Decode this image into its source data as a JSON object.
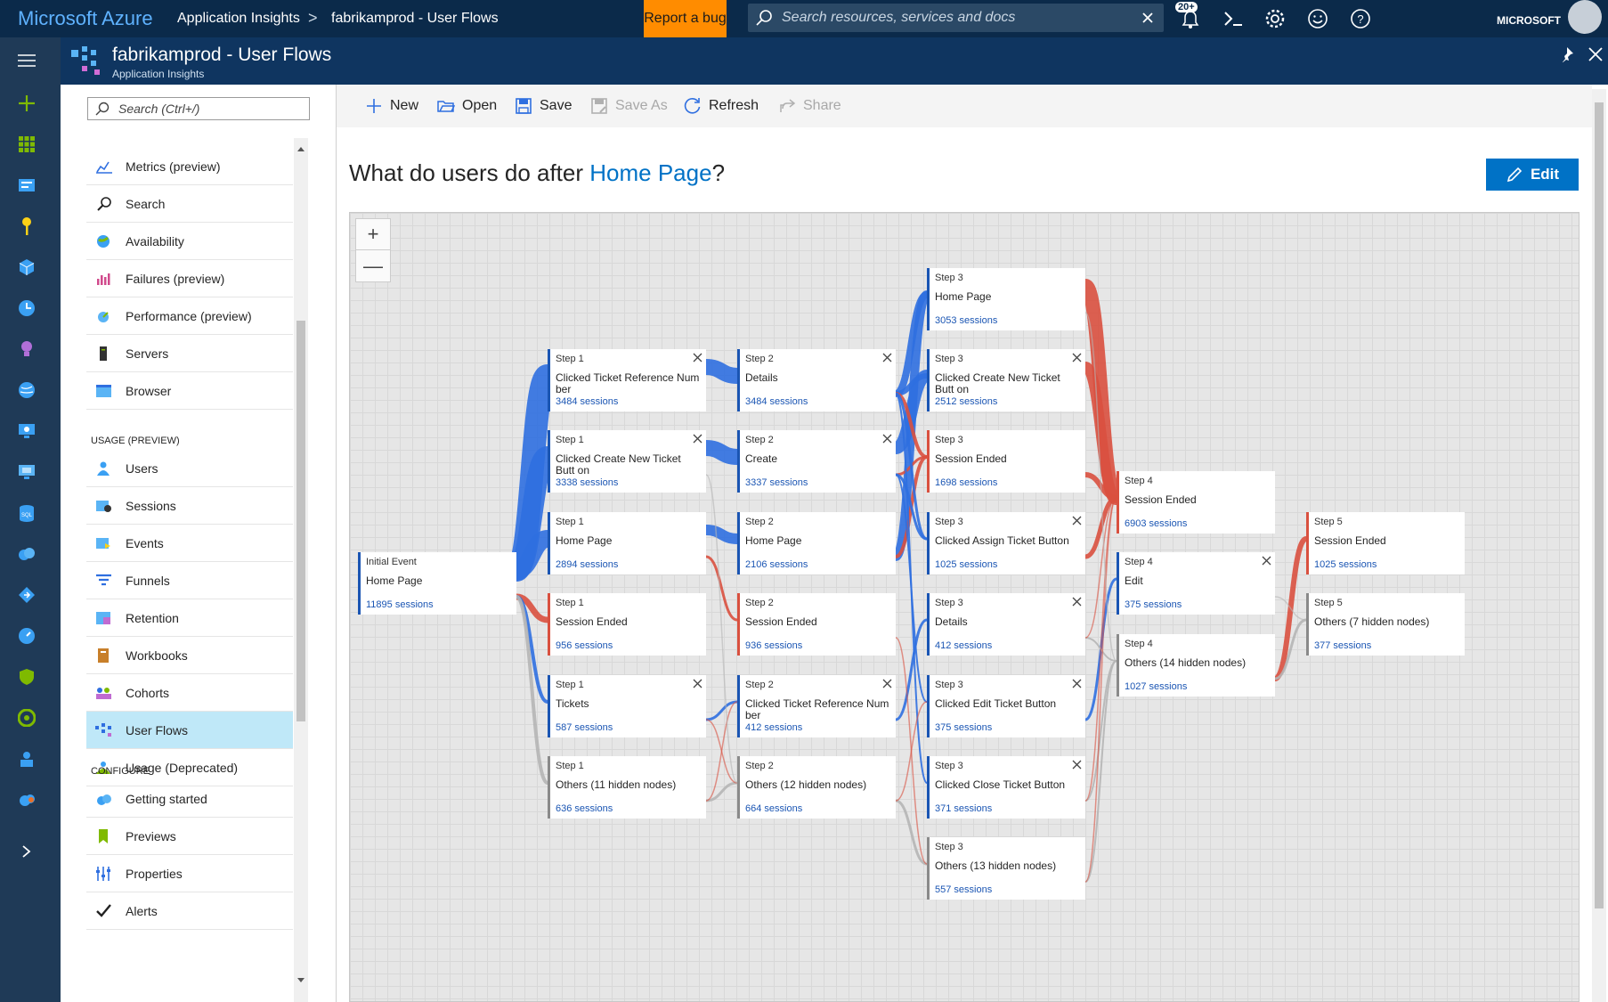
{
  "topbar": {
    "brand": "Microsoft Azure",
    "crumb_1": "Application Insights",
    "separator": ">",
    "crumb_2": "fabrikamprod - User Flows",
    "report_bug": "Report a bug",
    "search_placeholder": "Search resources, services and docs",
    "notifications_count": "20+",
    "account": "MICROSOFT"
  },
  "blade": {
    "title": "fabrikamprod - User Flows",
    "subtitle": "Application Insights"
  },
  "menu": {
    "search_placeholder": "Search (Ctrl+/)",
    "items_top": [
      {
        "label": "Metrics (preview)",
        "icon": "metrics-icon"
      },
      {
        "label": "Search",
        "icon": "search-icon"
      },
      {
        "label": "Availability",
        "icon": "availability-icon"
      },
      {
        "label": "Failures (preview)",
        "icon": "failures-icon"
      },
      {
        "label": "Performance (preview)",
        "icon": "performance-icon"
      },
      {
        "label": "Servers",
        "icon": "servers-icon"
      },
      {
        "label": "Browser",
        "icon": "browser-icon"
      }
    ],
    "section_usage": "USAGE (PREVIEW)",
    "items_usage": [
      {
        "label": "Users",
        "icon": "users-icon"
      },
      {
        "label": "Sessions",
        "icon": "sessions-icon"
      },
      {
        "label": "Events",
        "icon": "events-icon"
      },
      {
        "label": "Funnels",
        "icon": "funnels-icon"
      },
      {
        "label": "Retention",
        "icon": "retention-icon"
      },
      {
        "label": "Workbooks",
        "icon": "workbooks-icon"
      },
      {
        "label": "Cohorts",
        "icon": "cohorts-icon"
      },
      {
        "label": "User Flows",
        "icon": "user-flows-icon"
      },
      {
        "label": "Usage (Deprecated)",
        "icon": "usage-deprecated-icon"
      }
    ],
    "section_configure": "CONFIGURE",
    "items_configure": [
      {
        "label": "Getting started",
        "icon": "getting-started-icon"
      },
      {
        "label": "Previews",
        "icon": "previews-icon"
      },
      {
        "label": "Properties",
        "icon": "properties-icon"
      },
      {
        "label": "Alerts",
        "icon": "alerts-icon"
      }
    ]
  },
  "toolbar": {
    "new": "New",
    "open": "Open",
    "save": "Save",
    "save_as": "Save As",
    "refresh": "Refresh",
    "share": "Share"
  },
  "question": {
    "prefix": "What do users do after",
    "event": "Home Page",
    "suffix": "?"
  },
  "edit_label": "Edit",
  "colors": {
    "flow_blue": "#2f6fe0",
    "flow_red": "#d9503f",
    "flow_gray": "#b5b5b5",
    "accent": "#0072c6",
    "topbar": "#0b2a4a",
    "report_bug": "#ff8c00"
  },
  "flow": {
    "initial": {
      "step": "Initial Event",
      "name": "Home Page",
      "sessions": "11895 sessions"
    },
    "step1": [
      {
        "step": "Step 1",
        "name": "Clicked Ticket Reference Num ber",
        "sessions": "3484 sessions",
        "closable": true,
        "color": "blue"
      },
      {
        "step": "Step 1",
        "name": "Clicked Create New Ticket Butt on",
        "sessions": "3338 sessions",
        "closable": true,
        "color": "blue"
      },
      {
        "step": "Step 1",
        "name": "Home Page",
        "sessions": "2894 sessions",
        "closable": false,
        "color": "blue"
      },
      {
        "step": "Step 1",
        "name": "Session Ended",
        "sessions": "956 sessions",
        "closable": false,
        "color": "red"
      },
      {
        "step": "Step 1",
        "name": "Tickets",
        "sessions": "587 sessions",
        "closable": true,
        "color": "blue"
      },
      {
        "step": "Step 1",
        "name": "Others (11 hidden nodes)",
        "sessions": "636 sessions",
        "closable": false,
        "color": "gray"
      }
    ],
    "step2": [
      {
        "step": "Step 2",
        "name": "Details",
        "sessions": "3484 sessions",
        "closable": true,
        "color": "blue"
      },
      {
        "step": "Step 2",
        "name": "Create",
        "sessions": "3337 sessions",
        "closable": true,
        "color": "blue"
      },
      {
        "step": "Step 2",
        "name": "Home Page",
        "sessions": "2106 sessions",
        "closable": false,
        "color": "blue"
      },
      {
        "step": "Step 2",
        "name": "Session Ended",
        "sessions": "936 sessions",
        "closable": false,
        "color": "red"
      },
      {
        "step": "Step 2",
        "name": "Clicked Ticket Reference Num ber",
        "sessions": "412 sessions",
        "closable": true,
        "color": "blue"
      },
      {
        "step": "Step 2",
        "name": "Others (12 hidden nodes)",
        "sessions": "664 sessions",
        "closable": false,
        "color": "gray"
      }
    ],
    "step3": [
      {
        "step": "Step 3",
        "name": "Home Page",
        "sessions": "3053 sessions",
        "closable": false,
        "color": "blue"
      },
      {
        "step": "Step 3",
        "name": "Clicked Create New Ticket Butt on",
        "sessions": "2512 sessions",
        "closable": true,
        "color": "blue"
      },
      {
        "step": "Step 3",
        "name": "Session Ended",
        "sessions": "1698 sessions",
        "closable": false,
        "color": "red"
      },
      {
        "step": "Step 3",
        "name": "Clicked Assign Ticket Button",
        "sessions": "1025 sessions",
        "closable": true,
        "color": "blue"
      },
      {
        "step": "Step 3",
        "name": "Details",
        "sessions": "412 sessions",
        "closable": true,
        "color": "blue"
      },
      {
        "step": "Step 3",
        "name": "Clicked Edit Ticket Button",
        "sessions": "375 sessions",
        "closable": true,
        "color": "blue"
      },
      {
        "step": "Step 3",
        "name": "Clicked Close Ticket Button",
        "sessions": "371 sessions",
        "closable": true,
        "color": "blue"
      },
      {
        "step": "Step 3",
        "name": "Others (13 hidden nodes)",
        "sessions": "557 sessions",
        "closable": false,
        "color": "gray"
      }
    ],
    "step4": [
      {
        "step": "Step 4",
        "name": "Session Ended",
        "sessions": "6903 sessions",
        "closable": false,
        "color": "red"
      },
      {
        "step": "Step 4",
        "name": "Edit",
        "sessions": "375 sessions",
        "closable": true,
        "color": "blue"
      },
      {
        "step": "Step 4",
        "name": "Others (14 hidden nodes)",
        "sessions": "1027 sessions",
        "closable": false,
        "color": "gray"
      }
    ],
    "step5": [
      {
        "step": "Step 5",
        "name": "Session Ended",
        "sessions": "1025 sessions",
        "closable": false,
        "color": "red"
      },
      {
        "step": "Step 5",
        "name": "Others (7 hidden nodes)",
        "sessions": "377 sessions",
        "closable": false,
        "color": "gray"
      }
    ]
  }
}
